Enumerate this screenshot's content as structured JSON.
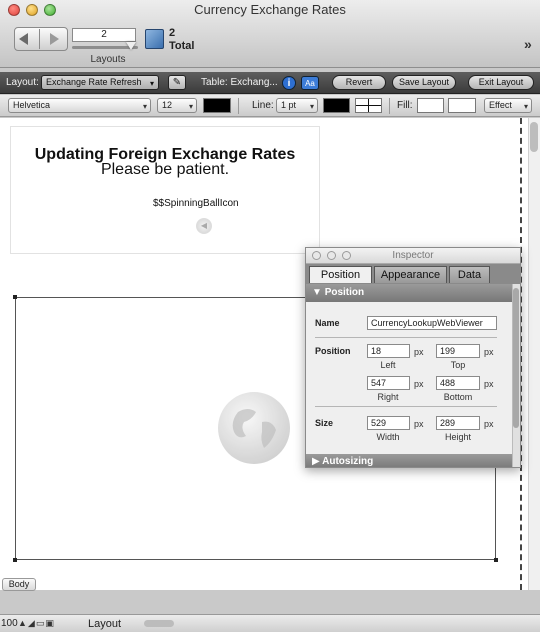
{
  "window": {
    "title": "Currency Exchange Rates"
  },
  "toolbar": {
    "page_value": "2",
    "layouts_caption": "Layouts",
    "record_count": "2",
    "record_total": "Total",
    "overflow": "»"
  },
  "layout_bar": {
    "layout_label": "Layout:",
    "layout_value": "Exchange Rate Refresh",
    "table_label": "Table: Exchang...",
    "info_glyph": "i",
    "format_glyph": "Aa",
    "revert_label": "Revert",
    "save_label": "Save Layout",
    "exit_label": "Exit Layout"
  },
  "format_bar": {
    "font_value": "Helvetica",
    "size_value": "12",
    "line_label": "Line:",
    "line_value": "1 pt",
    "fill_label": "Fill:",
    "effect_label": "Effect",
    "text_color": "#000000",
    "line_color": "#000000",
    "fill_color": "#ffffff"
  },
  "canvas": {
    "loading_title": "Updating Foreign Exchange Rates",
    "loading_subtitle": "Please be patient.",
    "spinner_field": "$$SpinningBallIcon",
    "part_label": "Body"
  },
  "status_bar": {
    "zoom": "100",
    "mode": "Layout"
  },
  "inspector": {
    "title": "Inspector",
    "tabs": [
      "Position",
      "Appearance",
      "Data"
    ],
    "active_tab": "Position",
    "position_section": "Position",
    "name_label": "Name",
    "name_value": "CurrencyLookupWebViewer",
    "position_label": "Position",
    "left": "18",
    "top": "199",
    "right": "547",
    "bottom": "488",
    "unit": "px",
    "left_caption": "Left",
    "top_caption": "Top",
    "right_caption": "Right",
    "bottom_caption": "Bottom",
    "size_label": "Size",
    "width": "529",
    "height": "289",
    "width_caption": "Width",
    "height_caption": "Height",
    "autosizing_section": "Autosizing"
  }
}
